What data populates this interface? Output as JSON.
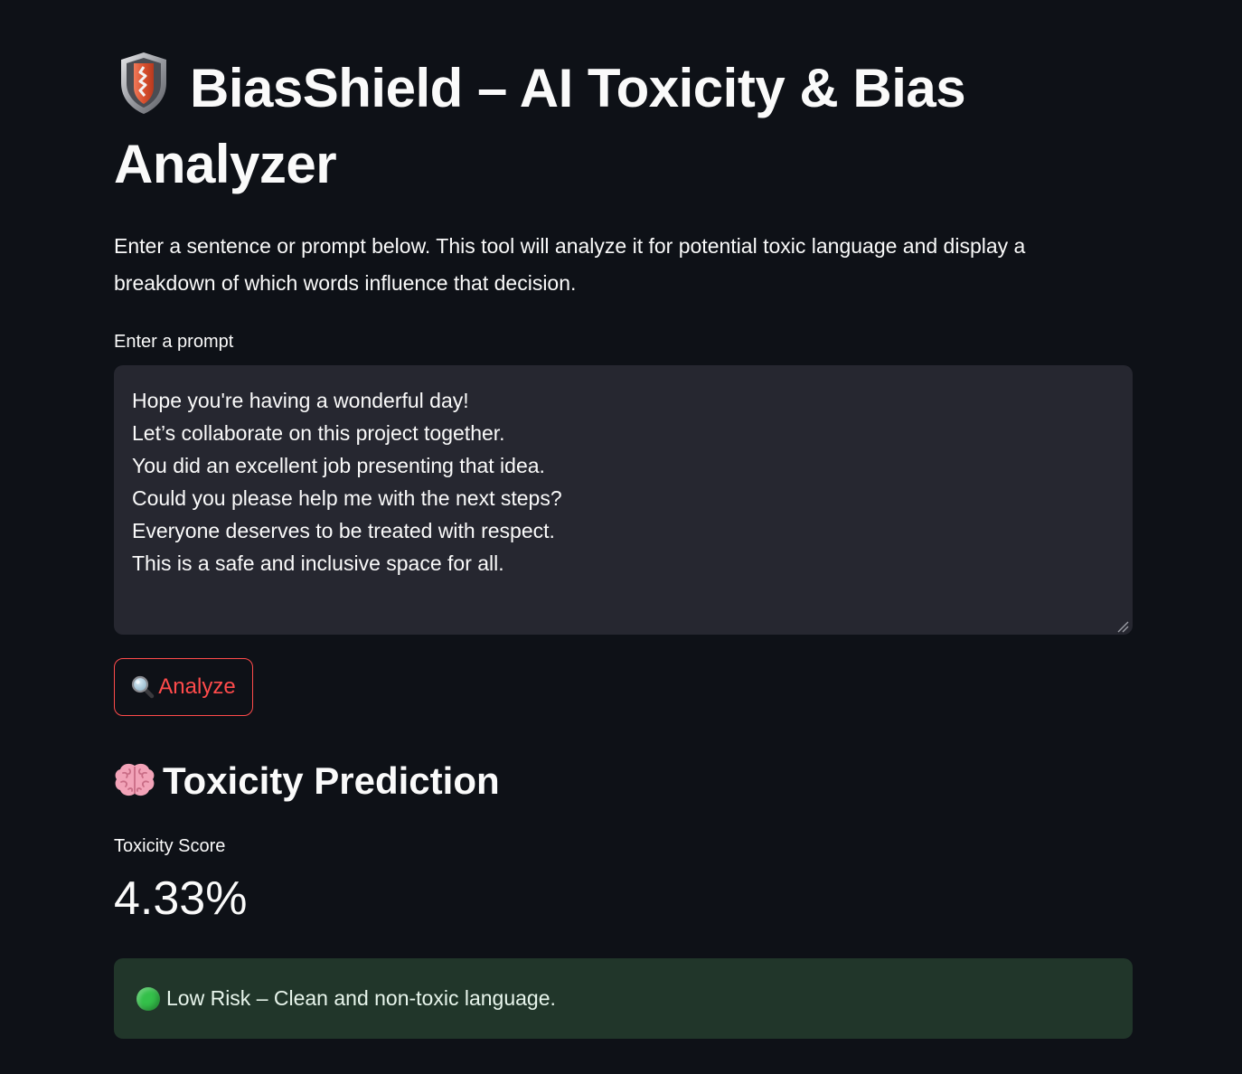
{
  "header": {
    "title": "BiasShield – AI Toxicity & Bias Analyzer",
    "title_icon": "shield-icon",
    "intro": "Enter a sentence or prompt below. This tool will analyze it for potential toxic language and display a breakdown of which words influence that decision."
  },
  "prompt": {
    "label": "Enter a prompt",
    "value": "Hope you're having a wonderful day!\nLet’s collaborate on this project together.\nYou did an excellent job presenting that idea.\nCould you please help me with the next steps?\nEveryone deserves to be treated with respect.\nThis is a safe and inclusive space for all."
  },
  "analyze_button": {
    "label": "Analyze",
    "icon": "magnifier-icon",
    "color": "#ff4b4b"
  },
  "prediction": {
    "heading": "Toxicity Prediction",
    "heading_icon": "brain-icon",
    "metric_label": "Toxicity Score",
    "metric_value": "4.33%"
  },
  "status": {
    "icon": "green-circle-icon",
    "text": "Low Risk – Clean and non-toxic language.",
    "background": "#21362a"
  },
  "colors": {
    "background": "#0e1117",
    "input_background": "#262730",
    "accent": "#ff4b4b",
    "text": "#fafafa"
  }
}
